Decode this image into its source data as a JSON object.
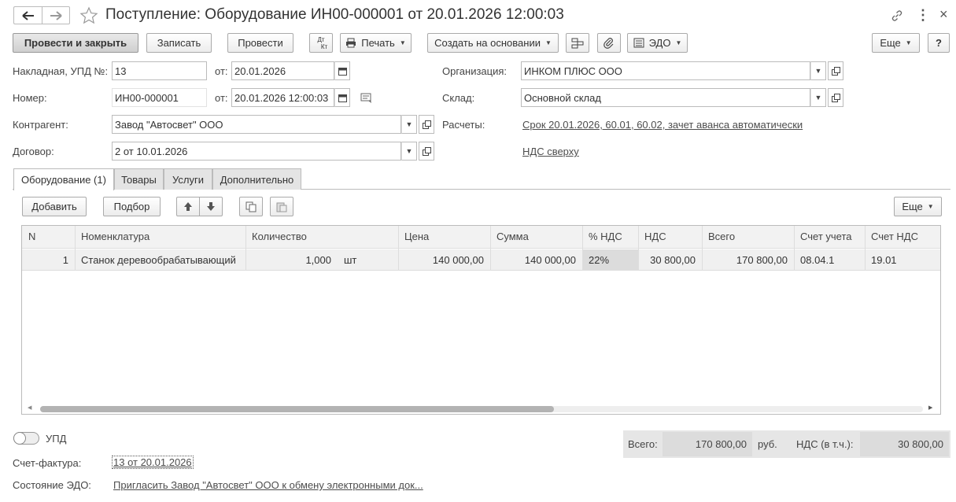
{
  "window": {
    "title": "Поступление: Оборудование ИН00-000001 от 20.01.2026 12:00:03",
    "close_glyph": "×",
    "more_glyph": "⋮"
  },
  "toolbar": {
    "post_close": "Провести и закрыть",
    "save": "Записать",
    "post": "Провести",
    "dtkt_top": "Дт",
    "dtkt_bottom": "Кт",
    "print": "Печать",
    "create_based": "Создать на основании",
    "edo": "ЭДО",
    "more": "Еще",
    "help": "?"
  },
  "form": {
    "invoice_label": "Накладная, УПД №:",
    "invoice_no": "13",
    "from_label": "от:",
    "invoice_date": "20.01.2026",
    "number_label": "Номер:",
    "number": "ИН00-000001",
    "doc_date": "20.01.2026 12:00:03",
    "counterparty_label": "Контрагент:",
    "counterparty": "Завод \"Автосвет\" ООО",
    "contract_label": "Договор:",
    "contract": "2 от 10.01.2026",
    "organization_label": "Организация:",
    "organization": "ИНКОМ ПЛЮС ООО",
    "warehouse_label": "Склад:",
    "warehouse": "Основной склад",
    "settlements_label": "Расчеты:",
    "settlements_link": "Срок 20.01.2026, 60.01, 60.02, зачет аванса автоматически",
    "vat_link": "НДС сверху"
  },
  "tabs": [
    "Оборудование (1)",
    "Товары",
    "Услуги",
    "Дополнительно"
  ],
  "table_toolbar": {
    "add": "Добавить",
    "pick": "Подбор",
    "more": "Еще"
  },
  "table": {
    "headers": [
      "N",
      "Номенклатура",
      "Количество",
      "Цена",
      "Сумма",
      "% НДС",
      "НДС",
      "Всего",
      "Счет учета",
      "Счет НДС"
    ],
    "rows": [
      {
        "n": "1",
        "item": "Станок деревообрабатывающий",
        "qty": "1,000",
        "unit": "шт",
        "price": "140 000,00",
        "sum": "140 000,00",
        "vat_rate": "22%",
        "vat": "30 800,00",
        "total": "170 800,00",
        "account": "08.04.1",
        "vat_account": "19.01"
      }
    ]
  },
  "footer": {
    "upd_label": "УПД",
    "invoice_label": "Счет-фактура:",
    "invoice_link": "13 от 20.01.2026",
    "edo_state_label": "Состояние ЭДО:",
    "edo_state_link": "Пригласить Завод \"Автосвет\" ООО к обмену электронными док...",
    "total_label": "Всего:",
    "total_value": "170 800,00",
    "currency": "руб.",
    "vat_incl_label": "НДС (в т.ч.):",
    "vat_incl_value": "30 800,00"
  }
}
